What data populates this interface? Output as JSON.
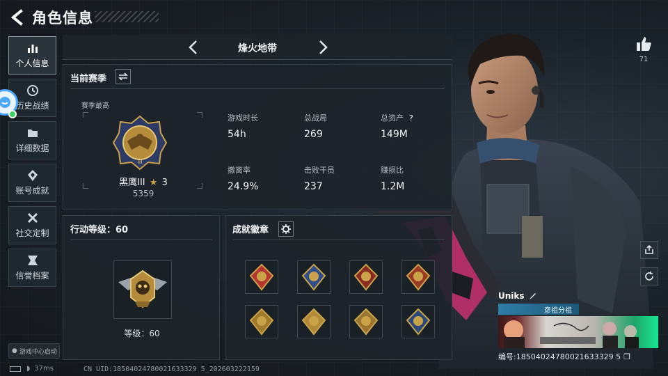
{
  "header": {
    "title": "角色信息"
  },
  "nav": {
    "items": [
      {
        "label": "个人信息",
        "active": true
      },
      {
        "label": "历史战绩",
        "active": false
      },
      {
        "label": "详细数据",
        "active": false
      },
      {
        "label": "账号成就",
        "active": false
      },
      {
        "label": "社交定制",
        "active": false
      },
      {
        "label": "信誉档案",
        "active": false
      }
    ],
    "game_center": "游戏中心启动"
  },
  "mode": {
    "name": "烽火地带"
  },
  "season": {
    "title": "当前赛季",
    "best_label": "赛季最高",
    "rank_name": "黑鹰III",
    "rank_stars": "3",
    "rank_score": "5359",
    "stats": [
      {
        "label": "游戏时长",
        "value": "54h"
      },
      {
        "label": "总战局",
        "value": "269"
      },
      {
        "label": "总资产",
        "value": "149M",
        "help": "?"
      },
      {
        "label": "撤离率",
        "value": "24.9%"
      },
      {
        "label": "击败干员",
        "value": "237"
      },
      {
        "label": "赚损比",
        "value": "1.2M"
      }
    ]
  },
  "level": {
    "title": "行动等级：60",
    "text": "等级：60"
  },
  "achievements": {
    "title": "成就徽章",
    "medal_colors": [
      "#b8342e",
      "#2f4d8c",
      "#8a2a22",
      "#9b3a24",
      "#a07a2a",
      "#b08a36",
      "#9a7530",
      "#2b4a7a"
    ]
  },
  "social": {
    "like_count": "71"
  },
  "player": {
    "name": "Uniks",
    "group": "彦祖分祖",
    "uid_label": "编号:18504024780021633329 5",
    "uid_text": "编号:18504024780021633329 5"
  },
  "status": {
    "ping": "37ms",
    "footer_uid": "CN UID:18504024780021633329 5_202603222159"
  },
  "colors": {
    "accent_gold": "#c9a24a",
    "like_blue": "#4aa7ff"
  }
}
